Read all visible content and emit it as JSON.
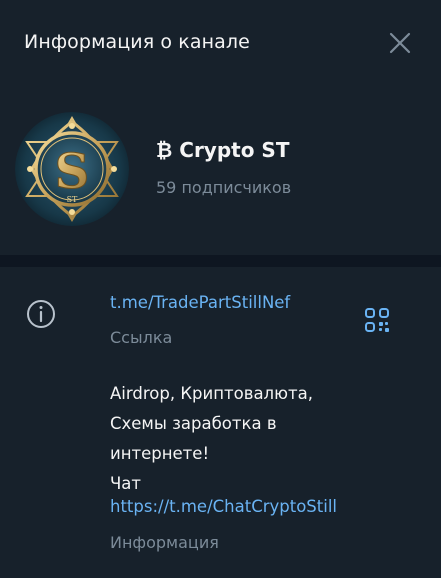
{
  "header": {
    "title": "Информация о канале",
    "close_icon": "close-icon"
  },
  "channel": {
    "name": "₿ Crypto ST",
    "subscribers": "59 подписчиков",
    "avatar_letter": "S",
    "avatar_small_letters": "ST"
  },
  "info": {
    "link": "t.me/TradePartStillNef",
    "link_label": "Ссылка",
    "description_lines": [
      "Airdrop, Криптовалюта,",
      "Схемы заработка в",
      "интернете!",
      "Чат"
    ],
    "chat_link": "https://t.me/ChatCryptoStill",
    "description_label": "Информация"
  },
  "colors": {
    "background": "#17212b",
    "divider": "#0e1621",
    "link": "#6ab3f3",
    "secondary_text": "#7c8b99",
    "primary_text": "#f5f5f5",
    "accent_gold": "#c9a45c"
  }
}
